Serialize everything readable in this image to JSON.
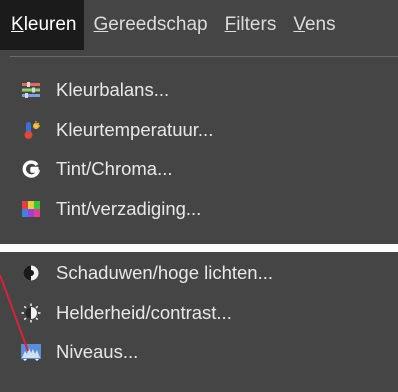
{
  "menubar": {
    "items": [
      {
        "label": "Kleuren",
        "active": true
      },
      {
        "label": "Gereedschap",
        "active": false
      },
      {
        "label": "Filters",
        "active": false
      },
      {
        "label": "Vens",
        "active": false
      }
    ]
  },
  "menu_top": {
    "items": [
      {
        "label": "Kleurbalans...",
        "icon": "color-balance-icon"
      },
      {
        "label": "Kleurtemperatuur...",
        "icon": "color-temperature-icon"
      },
      {
        "label": "Tint/Chroma...",
        "icon": "hue-chroma-icon"
      },
      {
        "label": "Tint/verzadiging...",
        "icon": "hue-saturation-icon"
      }
    ]
  },
  "menu_bottom": {
    "items": [
      {
        "label": "Schaduwen/hoge lichten...",
        "icon": "shadows-highlights-icon"
      },
      {
        "label": "Helderheid/contrast...",
        "icon": "brightness-contrast-icon"
      },
      {
        "label": "Niveaus...",
        "icon": "levels-icon"
      }
    ]
  },
  "colors": {
    "menu_bg": "#454545",
    "menubar_active_bg": "#1b1b1b",
    "annotation_line": "#d8213a"
  }
}
